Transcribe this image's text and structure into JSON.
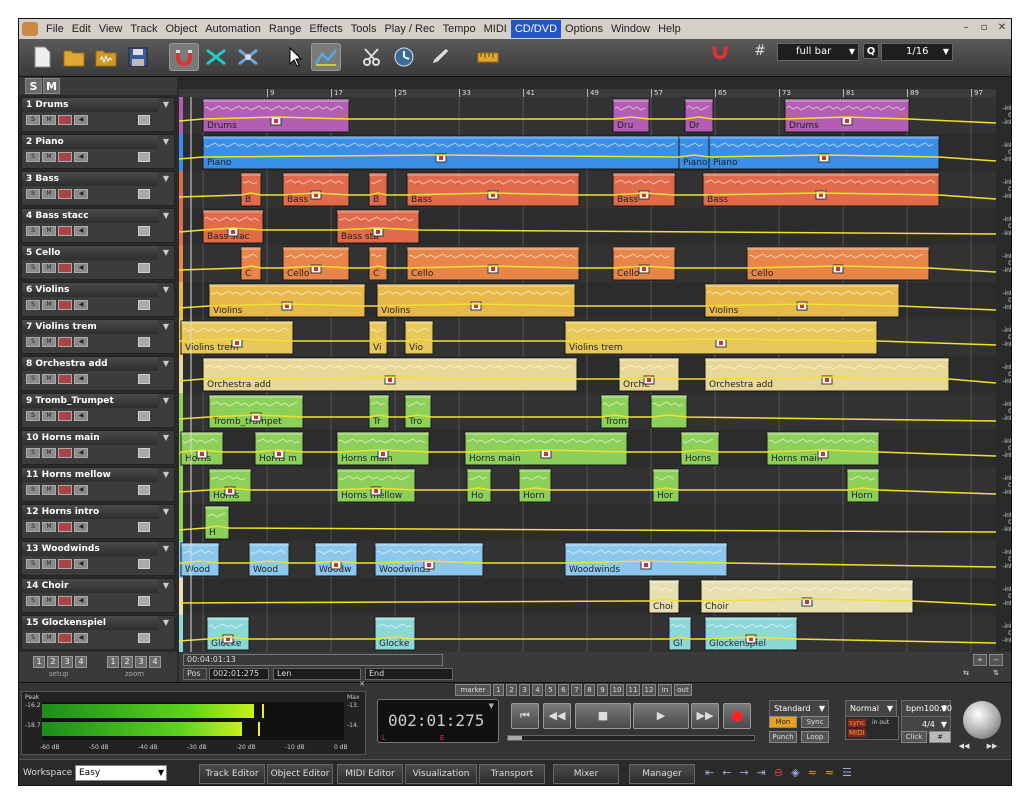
{
  "menu": [
    "File",
    "Edit",
    "View",
    "Track",
    "Object",
    "Automation",
    "Range",
    "Effects",
    "Tools",
    "Play / Rec",
    "Tempo",
    "MIDI",
    "CD/DVD",
    "Options",
    "Window",
    "Help"
  ],
  "menu_active": "CD/DVD",
  "toolbar": {
    "grid_value": "full bar",
    "quantize_label": "Q",
    "quantize_value": "1/16"
  },
  "solo_mute": {
    "solo": "S",
    "mute": "M"
  },
  "ruler_marks": [
    "9",
    "17",
    "25",
    "33",
    "41",
    "49",
    "57",
    "65",
    "73",
    "81",
    "89",
    "97"
  ],
  "tracks": [
    {
      "name": "1  Drums",
      "color": "#b35db3",
      "objects": [
        "Drums",
        "Dru",
        "Dr",
        "Drums"
      ]
    },
    {
      "name": "2  Piano",
      "color": "#3a8ee6",
      "objects": [
        "Piano",
        "Piano",
        "Piano"
      ]
    },
    {
      "name": "3  Bass",
      "color": "#e06a4a",
      "objects": [
        "B",
        "Bass",
        "B",
        "Bass",
        "Bass",
        "Bass"
      ]
    },
    {
      "name": "4  Bass stacc",
      "color": "#e06a4a",
      "objects": [
        "Bass stac",
        "Bass sta"
      ]
    },
    {
      "name": "5  Cello",
      "color": "#e8864a",
      "objects": [
        "C",
        "Cello",
        "C",
        "Cello",
        "Cello",
        "Cello"
      ]
    },
    {
      "name": "6  Violins",
      "color": "#e8b84a",
      "objects": [
        "Violins",
        "Violins",
        "Violins"
      ]
    },
    {
      "name": "7  Violins trem",
      "color": "#e8c85a",
      "objects": [
        "Violins trem",
        "Vi",
        "Vio",
        "Violins trem"
      ]
    },
    {
      "name": "8  Orchestra add",
      "color": "#e8d898",
      "objects": [
        "Orchestra add",
        "Orche",
        "Orchestra add"
      ]
    },
    {
      "name": "9  Tromb_Trumpet",
      "color": "#8cd05a",
      "objects": [
        "Tromb_trumpet",
        "Tr",
        "Tro",
        "Trom"
      ]
    },
    {
      "name": "10  Horns main",
      "color": "#8cd05a",
      "objects": [
        "Horns",
        "Horns m",
        "Horns main",
        "Horns main",
        "Horns",
        "Horns main"
      ]
    },
    {
      "name": "11  Horns mellow",
      "color": "#8cd05a",
      "objects": [
        "Horns",
        "Horns mellow",
        "Ho",
        "Horn",
        "Hor",
        "Horn"
      ]
    },
    {
      "name": "12  Horns intro",
      "color": "#8cd05a",
      "objects": [
        "H"
      ]
    },
    {
      "name": "13  Woodwinds",
      "color": "#8cc8ee",
      "objects": [
        "Wood",
        "Wood",
        "Woodw",
        "Woodwinds",
        "Woodwinds"
      ]
    },
    {
      "name": "14  Choir",
      "color": "#e8e0b0",
      "objects": [
        "Choi",
        "Choir"
      ]
    },
    {
      "name": "15  Glockenspiel",
      "color": "#8cd8d8",
      "objects": [
        "Glocke",
        "Glocke",
        "Gl",
        "Glockenspiel"
      ]
    }
  ],
  "volume_labels": [
    "-inf",
    "0",
    "-inf"
  ],
  "screen_sets": {
    "setup_label": "setup",
    "zoom_label": "zoom",
    "numbers": [
      "1",
      "2",
      "3",
      "4"
    ]
  },
  "position": {
    "marker_time": "00:04:01:13",
    "pos_label": "Pos",
    "pos_value": "002:01:275",
    "len_label": "Len",
    "end_label": "End"
  },
  "meter": {
    "peak_label": "Peak",
    "max_label": "Max",
    "peak_l": "-16.2",
    "peak_r": "-18.7",
    "max_l": "-13.",
    "max_r": "-14.",
    "scale": [
      "-60 dB",
      "-50 dB",
      "-40 dB",
      "-30 dB",
      "-20 dB",
      "-10 dB",
      "0 dB"
    ]
  },
  "transport": {
    "timecode": "002:01:275",
    "loop_l": "L",
    "loop_e": "E",
    "marker_label": "marker",
    "marker_numbers": [
      "1",
      "2",
      "3",
      "4",
      "5",
      "6",
      "7",
      "8",
      "9",
      "10",
      "11",
      "12"
    ],
    "in_label": "in",
    "out_label": "out",
    "mode": "Standard",
    "mon": "Mon",
    "sync": "Sync",
    "punch": "Punch",
    "loop": "Loop",
    "normal": "Normal",
    "bpm": "bpm100.00",
    "signature": "4/4",
    "click": "Click",
    "sync_badge": "sync",
    "midi_badge": "MIDI",
    "inout_label": "in out"
  },
  "workspace": {
    "label": "Workspace",
    "value": "Easy"
  },
  "taskbar": [
    "Track Editor",
    "Object Editor",
    "MIDI Editor",
    "Visualization",
    "Transport",
    "Mixer",
    "Manager"
  ]
}
